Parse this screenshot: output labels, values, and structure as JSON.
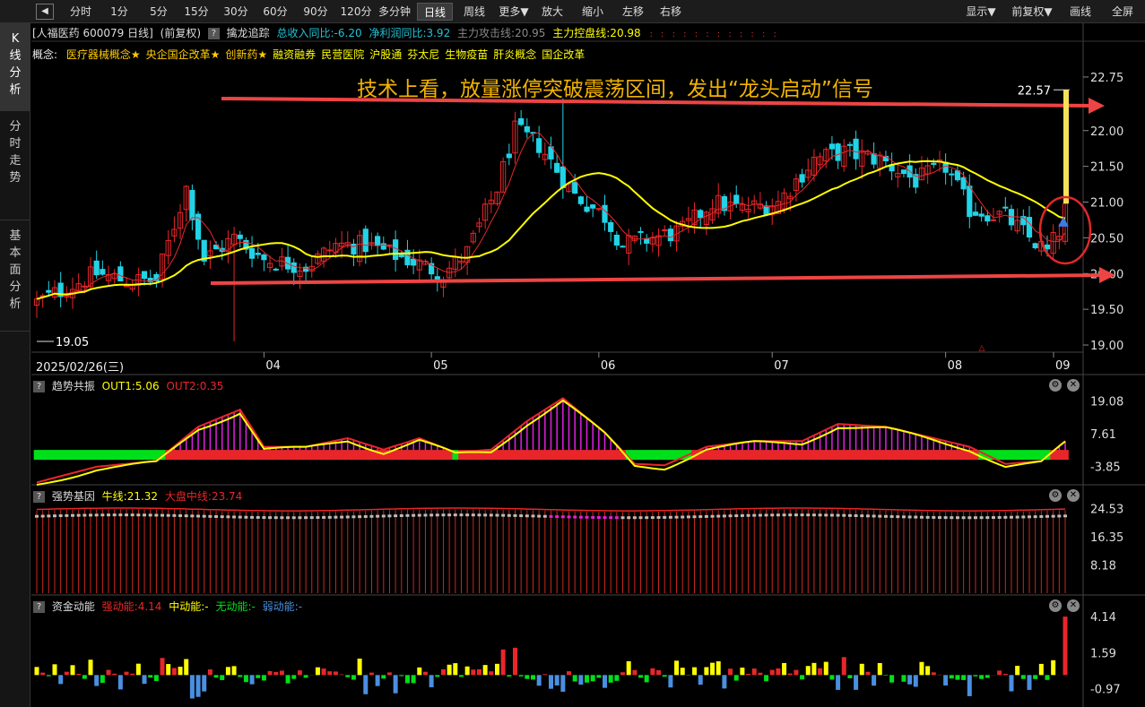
{
  "toolbar": {
    "left": [
      "分时",
      "1分",
      "5分",
      "15分",
      "30分",
      "60分",
      "90分",
      "120分",
      "多分钟",
      "日线",
      "周线",
      "更多▼",
      "放大",
      "缩小",
      "左移",
      "右移"
    ],
    "right": [
      "显示▼",
      "前复权▼",
      "画线",
      "全屏"
    ],
    "active": "日线"
  },
  "sidenav": [
    {
      "label": "K线分析",
      "active": true
    },
    {
      "label": "分时走势",
      "active": false
    },
    {
      "label": "基本面分析",
      "active": false
    }
  ],
  "header": {
    "stock": "[人福医药 600079 日线]",
    "adjust": "(前复权)",
    "indicator_name": "擒龙追踪",
    "revenue_yoy": "总收入同比:-6.20",
    "profit_yoy": "净利润同比:3.92",
    "attack_line": "主力攻击线:20.95",
    "control_line": "主力控盘线:20.98"
  },
  "concepts": {
    "label": "概念:",
    "items": [
      "医疗器械概念★",
      "央企国企改革★",
      "创新药★",
      "融资融券",
      "民营医院",
      "沪股通",
      "芬太尼",
      "生物疫苗",
      "肝炎概念",
      "国企改革"
    ]
  },
  "annotation": "技术上看，放量涨停突破震荡区间，发出“龙头启动”信号",
  "colors": {
    "up": "#e8262a",
    "down": "#22d3e6",
    "ma_yellow": "#ffff00",
    "ma_red": "#e8262a",
    "ma_gray": "#bbbbbb",
    "arrow": "#ee4444",
    "green": "#00e01a",
    "magenta": "#e020e0"
  },
  "chart_data": [
    {
      "type": "candlestick",
      "title": "人福医药 600079 日线",
      "x_start": "2025/02/26(三)",
      "month_labels": [
        "04",
        "05",
        "06",
        "07",
        "08",
        "09"
      ],
      "y_ticks": [
        22.75,
        22.0,
        21.5,
        21.0,
        20.5,
        20.0,
        19.5,
        19.0
      ],
      "ylim": [
        18.9,
        23.0
      ],
      "high_mark": 22.57,
      "low_mark": 19.05,
      "close_path": [
        {
          "day": 0,
          "close": 19.6
        },
        {
          "day": 5,
          "close": 19.8
        },
        {
          "day": 10,
          "close": 20.0
        },
        {
          "day": 15,
          "close": 19.9
        },
        {
          "day": 20,
          "close": 19.9
        },
        {
          "day": 25,
          "close": 21.2
        },
        {
          "day": 28,
          "close": 20.2
        },
        {
          "day": 33,
          "close": 20.5
        },
        {
          "day": 38,
          "close": 20.2
        },
        {
          "day": 45,
          "close": 20.1
        },
        {
          "day": 50,
          "close": 20.4
        },
        {
          "day": 55,
          "close": 20.4
        },
        {
          "day": 62,
          "close": 20.2
        },
        {
          "day": 68,
          "close": 20.0
        },
        {
          "day": 72,
          "close": 20.3
        },
        {
          "day": 77,
          "close": 21.2
        },
        {
          "day": 80,
          "close": 22.0
        },
        {
          "day": 84,
          "close": 21.8
        },
        {
          "day": 90,
          "close": 21.1
        },
        {
          "day": 95,
          "close": 20.8
        },
        {
          "day": 98,
          "close": 20.4
        },
        {
          "day": 103,
          "close": 20.5
        },
        {
          "day": 108,
          "close": 20.6
        },
        {
          "day": 113,
          "close": 21.0
        },
        {
          "day": 118,
          "close": 20.9
        },
        {
          "day": 124,
          "close": 21.0
        },
        {
          "day": 130,
          "close": 21.6
        },
        {
          "day": 135,
          "close": 21.7
        },
        {
          "day": 141,
          "close": 21.6
        },
        {
          "day": 147,
          "close": 21.3
        },
        {
          "day": 152,
          "close": 21.5
        },
        {
          "day": 156,
          "close": 20.9
        },
        {
          "day": 162,
          "close": 20.8
        },
        {
          "day": 166,
          "close": 20.5
        },
        {
          "day": 169,
          "close": 20.3
        },
        {
          "day": 171,
          "close": 20.6
        },
        {
          "day": 172,
          "close": 20.98
        }
      ]
    },
    {
      "type": "bar",
      "name": "趋势共振",
      "series_labels": {
        "out1": "OUT1:5.06",
        "out2": "OUT2:0.35"
      },
      "y_ticks": [
        19.08,
        7.61,
        -3.85
      ],
      "ylim": [
        -10,
        22
      ],
      "values_path": [
        {
          "day": 0,
          "value": -9.5
        },
        {
          "day": 10,
          "value": -4
        },
        {
          "day": 20,
          "value": -2
        },
        {
          "day": 27,
          "value": 10
        },
        {
          "day": 34,
          "value": 16
        },
        {
          "day": 38,
          "value": 3
        },
        {
          "day": 45,
          "value": 3
        },
        {
          "day": 52,
          "value": 6
        },
        {
          "day": 58,
          "value": 2
        },
        {
          "day": 64,
          "value": 6
        },
        {
          "day": 70,
          "value": 1
        },
        {
          "day": 76,
          "value": 2
        },
        {
          "day": 82,
          "value": 12
        },
        {
          "day": 88,
          "value": 20
        },
        {
          "day": 95,
          "value": 8
        },
        {
          "day": 100,
          "value": -3
        },
        {
          "day": 105,
          "value": -3.5
        },
        {
          "day": 112,
          "value": 3
        },
        {
          "day": 120,
          "value": 5
        },
        {
          "day": 128,
          "value": 5
        },
        {
          "day": 134,
          "value": 11
        },
        {
          "day": 142,
          "value": 10
        },
        {
          "day": 150,
          "value": 6
        },
        {
          "day": 156,
          "value": 3
        },
        {
          "day": 162,
          "value": -3
        },
        {
          "day": 168,
          "value": -2
        },
        {
          "day": 172,
          "value": 5
        }
      ]
    },
    {
      "type": "bar",
      "name": "强势基因",
      "series_labels": {
        "bull": "牛线:21.32",
        "market": "大盘中线:23.74"
      },
      "y_ticks": [
        24.53,
        16.35,
        8.18
      ],
      "ylim": [
        0,
        26
      ],
      "level": 24
    },
    {
      "type": "bar",
      "name": "资金动能",
      "series_labels": {
        "strong": "强动能:4.14",
        "mid": "中动能:-",
        "none": "无动能:-",
        "weak": "弱动能:-"
      },
      "y_ticks": [
        4.14,
        1.59,
        -0.97
      ],
      "ylim": [
        -2.2,
        4.4
      ],
      "last_value": 4.14
    }
  ]
}
